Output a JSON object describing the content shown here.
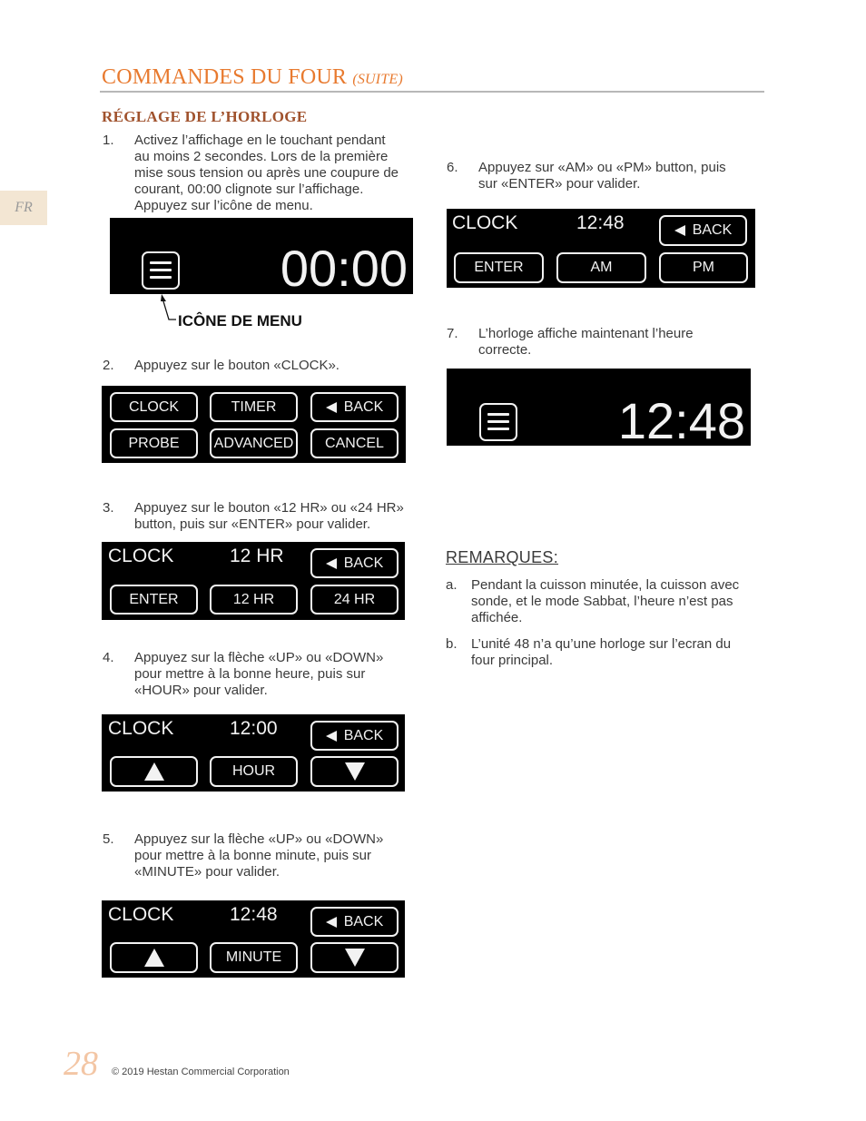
{
  "header": {
    "title": "COMMANDES DU FOUR",
    "title_suffix": "(SUITE)",
    "section": "RÉGLAGE DE L’HORLOGE",
    "lang_tab": "FR"
  },
  "colors": {
    "title": "#e87a2f",
    "section": "#a0522d",
    "lang_tab_bg": "#f3e6d3",
    "page_number": "#f3c6a5"
  },
  "steps": [
    {
      "num": "1.",
      "lines": [
        "Activez l’affichage en le touchant pendant",
        "au moins 2 secondes.  Lors de la première",
        "mise sous tension ou après une coupure de",
        "courant, 00:00 clignote sur l’affichage.",
        "Appuyez sur l’icône de menu."
      ],
      "screen": {
        "icon": "menu-icon",
        "time": "00:00"
      },
      "callout": "ICÔNE DE MENU"
    },
    {
      "num": "2.",
      "lines": [
        "Appuyez sur le bouton «CLOCK»."
      ],
      "screen": {
        "buttons": [
          "CLOCK",
          "TIMER",
          "BACK",
          "PROBE",
          "ADVANCED",
          "CANCEL"
        ]
      }
    },
    {
      "num": "3.",
      "lines": [
        "Appuyez sur le bouton «12 HR» ou «24 HR»",
        "button, puis sur «ENTER» pour valider."
      ],
      "screen": {
        "label": "CLOCK",
        "value": "12 HR",
        "back": "BACK",
        "buttons": [
          "ENTER",
          "12 HR",
          "24 HR"
        ]
      }
    },
    {
      "num": "4.",
      "lines": [
        "Appuyez sur la flèche «UP» ou «DOWN»",
        "pour mettre à la bonne heure, puis sur",
        "«HOUR» pour valider."
      ],
      "screen": {
        "label": "CLOCK",
        "value": "12:00",
        "back": "BACK",
        "buttons": [
          "up-arrow",
          "HOUR",
          "down-arrow"
        ]
      }
    },
    {
      "num": "5.",
      "lines": [
        "Appuyez sur la flèche «UP» ou «DOWN»",
        "pour mettre à la bonne minute, puis sur",
        "«MINUTE» pour valider."
      ],
      "screen": {
        "label": "CLOCK",
        "value": "12:48",
        "back": "BACK",
        "buttons": [
          "up-arrow",
          "MINUTE",
          "down-arrow"
        ]
      }
    },
    {
      "num": "6.",
      "lines": [
        "Appuyez sur «AM» ou «PM» button, puis",
        "sur «ENTER» pour valider."
      ],
      "screen": {
        "label": "CLOCK",
        "value": "12:48",
        "back": "BACK",
        "buttons": [
          "ENTER",
          "AM",
          "PM"
        ]
      }
    },
    {
      "num": "7.",
      "lines": [
        "L’horloge affiche maintenant l’heure",
        "correcte."
      ],
      "screen": {
        "icon": "menu-icon",
        "time": "12:48"
      }
    }
  ],
  "remarks": {
    "title": "REMARQUES:",
    "items": [
      {
        "num": "a.",
        "lines": [
          "Pendant la cuisson minutée, la cuisson avec",
          "sonde, et le mode Sabbat, l’heure n’est pas",
          "affichée."
        ]
      },
      {
        "num": "b.",
        "lines": [
          "L’unité 48 n’a qu’une horloge sur l’ecran du",
          "four principal."
        ]
      }
    ]
  },
  "footer": {
    "page_number": "28",
    "copyright": "© 2019 Hestan Commercial Corporation"
  }
}
